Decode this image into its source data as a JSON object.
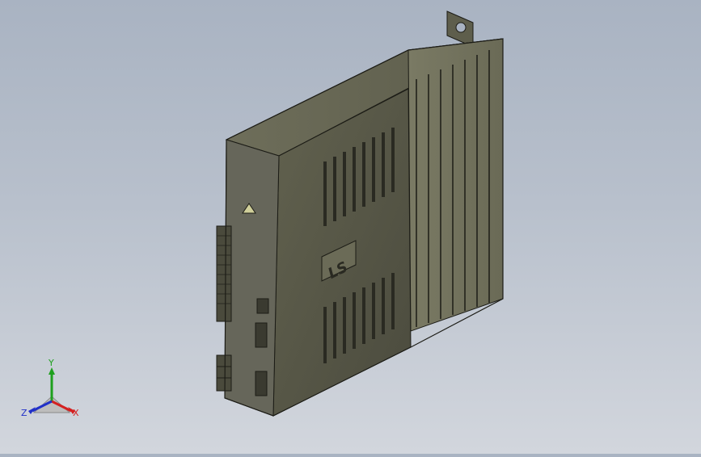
{
  "viewport": {
    "background_top": "#a9b3c2",
    "background_bottom": "#d2d6dd"
  },
  "model": {
    "name": "servo-drive-assembly",
    "brand_logo": "LS",
    "body_color": "#5a5a4c",
    "edge_color": "#1c1c16"
  },
  "triad": {
    "x_label": "X",
    "y_label": "Y",
    "z_label": "Z",
    "x_color": "#d42020",
    "y_color": "#1ea01e",
    "z_color": "#2030c8"
  }
}
